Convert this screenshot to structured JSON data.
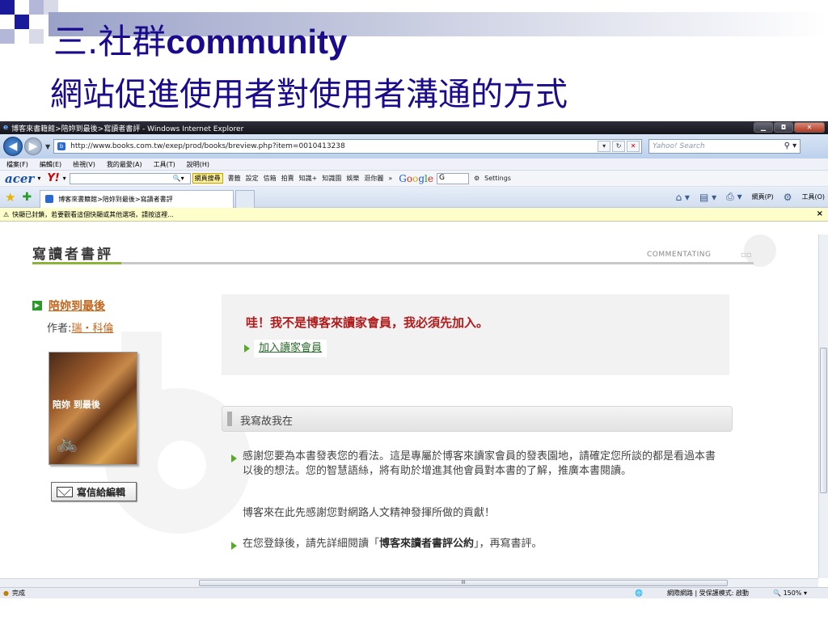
{
  "slide": {
    "title_line1_cjk": "三.社群",
    "title_line1_latin": "community",
    "title_line2": "網站促進使用者對使用者溝通的方式"
  },
  "browser": {
    "window_title": "博客來書籍館>陪妳到最後>寫讀者書評 - Windows Internet Explorer",
    "url": "http://www.books.com.tw/exep/prod/books/breview.php?item=0010413238",
    "search_placeholder": "Yahoo! Search",
    "menu": [
      "檔案(F)",
      "編輯(E)",
      "檢視(V)",
      "我的最愛(A)",
      "工具(T)",
      "說明(H)"
    ],
    "acer_toolbar": {
      "logo": "acer",
      "yahoo": "Y!",
      "search_btn": "網頁搜尋",
      "items": [
        "書籤",
        "設定",
        "信箱",
        "拍賣",
        "知識+",
        "知識園",
        "娛樂",
        "逛你麗",
        "»"
      ],
      "google": [
        "G",
        "o",
        "o",
        "g",
        "l",
        "e"
      ],
      "google_input": "G",
      "settings": "Settings"
    },
    "tab_label": "博客來書籍館>陪妳到最後>寫讀者書評",
    "cmd": [
      "網頁(P)",
      "工具(O)"
    ],
    "infobar_text": "快顯已封鎖，若要觀看這個快顯或其他選項，請按這裡...",
    "status_text": "完成",
    "status_zone": "網際網路 | 受保護模式: 啟動",
    "zoom": "150%"
  },
  "page": {
    "section_title": "寫讀者書評",
    "section_sub": "COMMENTATING",
    "book_title": "陪妳到最後",
    "author_label": "作者:",
    "author_name": "瑞・科倫",
    "cover_text": "陪妳 到最後",
    "write_btn": "寫信給編輯",
    "notice": "哇！我不是博客來讀家會員，我必須先加入。",
    "join_link": "加入讀家會員",
    "mid_bar": "我寫故我在",
    "para1": "感謝您要為本書發表您的看法。這是專屬於博客來讀家會員的發表園地，請確定您所談的都是看過本書以後的想法。您的智慧語絲，將有助於增進其他會員對本書的了解，推廣本書閱讀。",
    "para2": "博客來在此先感謝您對網路人文精神發揮所做的貢獻！",
    "para3_pre": "在您登錄後，請先詳細閱讀「",
    "para3_bold": "博客來讀者書評公約",
    "para3_post": "」，再寫書評。"
  },
  "colors": {
    "slide_title": "#1a0a8c",
    "accent_orange": "#c2641a",
    "notice_red": "#b01a1a",
    "green": "#5aaa2a"
  }
}
